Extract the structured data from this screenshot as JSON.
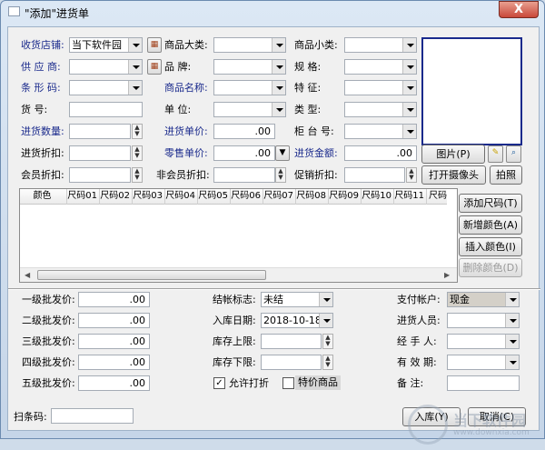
{
  "window": {
    "title": "\"添加\"进货单",
    "close_glyph": "X"
  },
  "top_fields": {
    "store_label": "收货店铺:",
    "store_value": "当下软件园",
    "supplier_label": "供 应 商:",
    "barcode_label": "条 形 码:",
    "sku_label": "货     号:",
    "qty_label": "进货数量:",
    "discount_label": "进货折扣:",
    "member_discount_label": "会员折扣:",
    "category_label": "商品大类:",
    "brand_label": "品     牌:",
    "name_label": "商品名称:",
    "unit_label": "单     位:",
    "price_label": "进货单价:",
    "price_value": ".00",
    "retail_label": "零售单价:",
    "retail_value": ".00",
    "nonmember_discount_label": "非会员折扣:",
    "subcategory_label": "商品小类:",
    "spec_label": "规     格:",
    "feature_label": "特     征:",
    "type_label": "类     型:",
    "counter_label": "柜 台 号:",
    "amount_label": "进货金额:",
    "amount_value": ".00",
    "promo_discount_label": "促销折扣:"
  },
  "photo_buttons": {
    "photo": "图片(P)",
    "open_camera": "打开摄像头",
    "capture": "拍照"
  },
  "grid": {
    "columns": [
      "颜色",
      "尺码01",
      "尺码02",
      "尺码03",
      "尺码04",
      "尺码05",
      "尺码06",
      "尺码07",
      "尺码08",
      "尺码09",
      "尺码10",
      "尺码11",
      "尺码"
    ],
    "side_buttons": [
      "添加尺码(T)",
      "新增颜色(A)",
      "插入颜色(I)",
      "删除颜色(D)"
    ]
  },
  "bottom": {
    "wholesale1_label": "一级批发价:",
    "wholesale1": ".00",
    "wholesale2_label": "二级批发价:",
    "wholesale2": ".00",
    "wholesale3_label": "三级批发价:",
    "wholesale3": ".00",
    "wholesale4_label": "四级批发价:",
    "wholesale4": ".00",
    "wholesale5_label": "五级批发价:",
    "wholesale5": ".00",
    "settle_label": "结帐标志:",
    "settle_value": "未结",
    "date_label": "入库日期:",
    "date_value": "2018-10-18",
    "stock_max_label": "库存上限:",
    "stock_min_label": "库存下限:",
    "allow_discount_label": "允许打折",
    "allow_discount_checked": "✓",
    "special_label": "特价商品",
    "account_label": "支付帐户:",
    "account_value": "现金",
    "buyer_label": "进货人员:",
    "handler_label": "经 手 人:",
    "expiry_label": "有 效 期:",
    "note_label": "备     注:"
  },
  "footer": {
    "scan_label": "扫条码:",
    "save_button": "入库(Y)",
    "cancel_button": "取消(C)"
  },
  "watermark": {
    "title": "当下软件园",
    "sub": "www.downxia.com"
  }
}
